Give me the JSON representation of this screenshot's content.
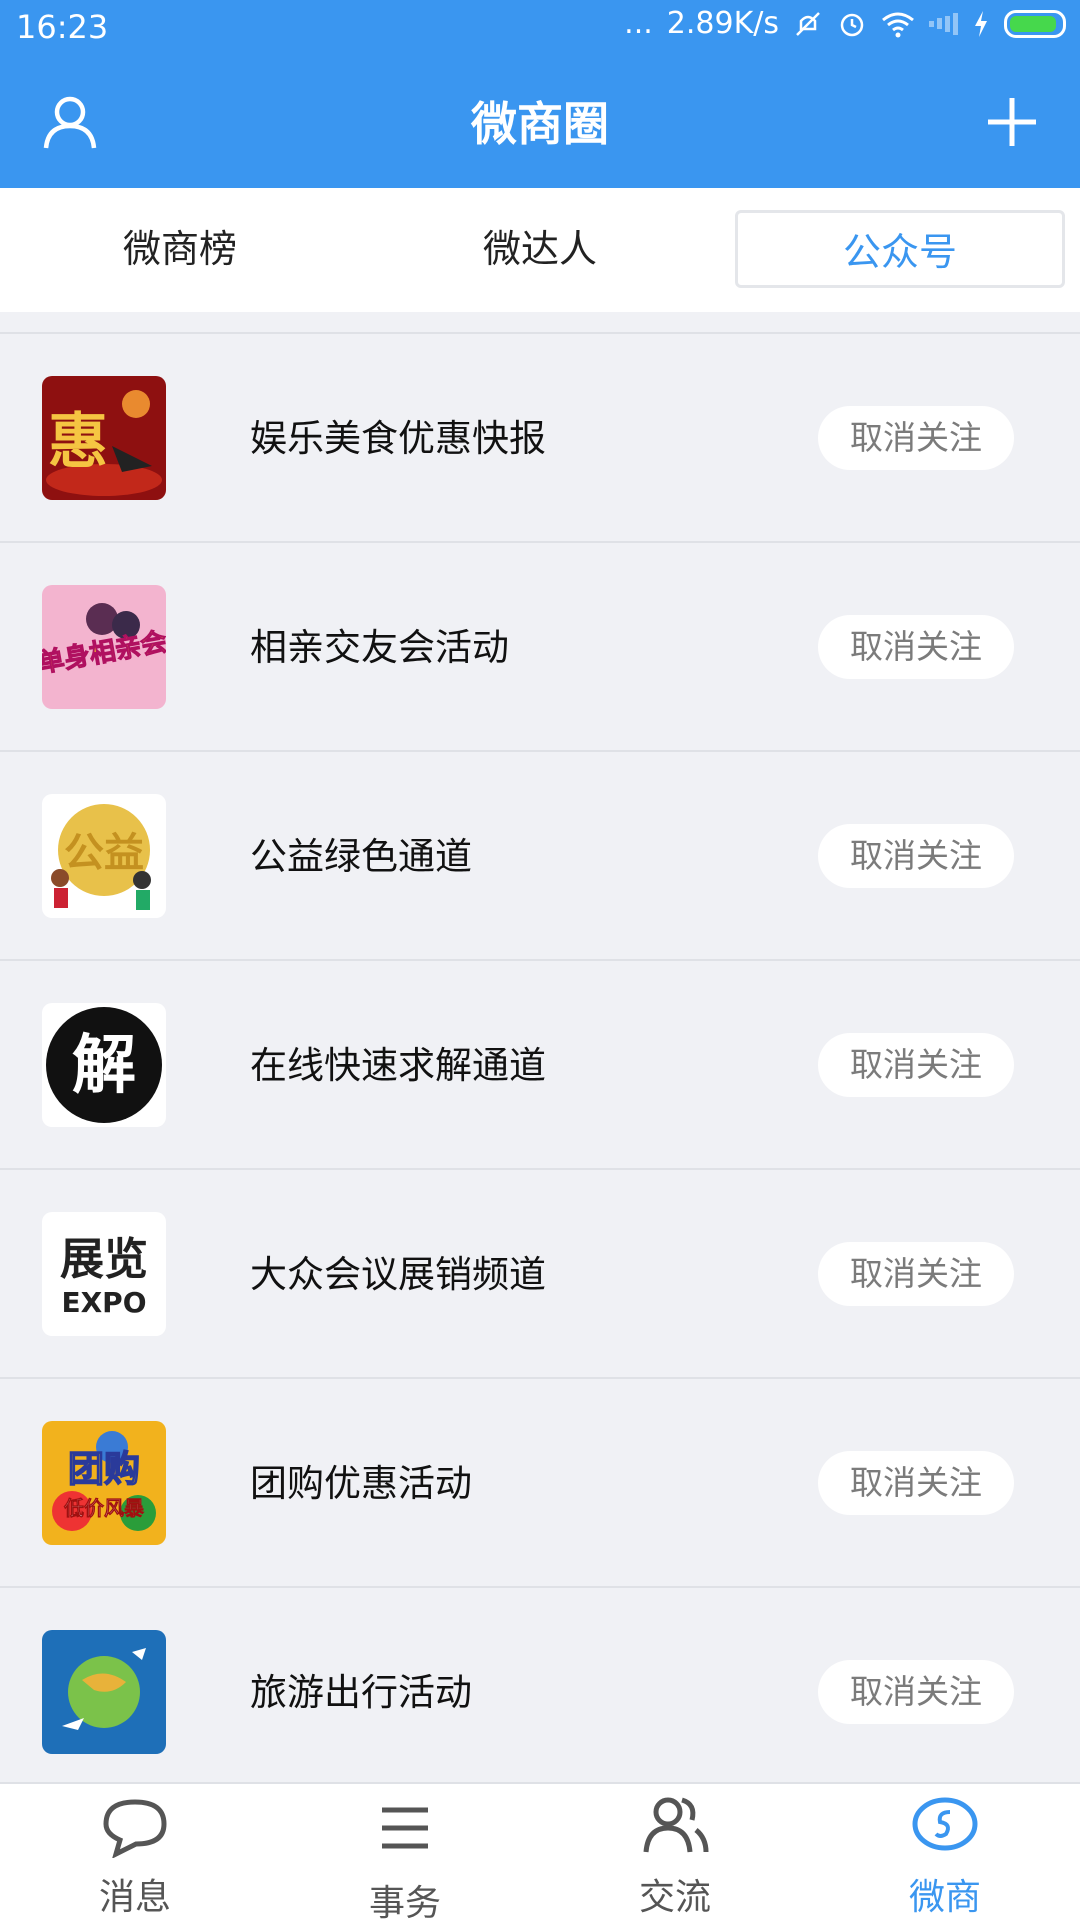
{
  "status_bar": {
    "time": "16:23",
    "dots": "...",
    "speed": "2.89K/s"
  },
  "header": {
    "title": "微商圈",
    "left_icon": "user-icon",
    "right_icon": "plus-icon"
  },
  "tabs": [
    {
      "label": "微商榜",
      "active": false
    },
    {
      "label": "微达人",
      "active": false
    },
    {
      "label": "公众号",
      "active": true
    }
  ],
  "list": {
    "button_label": "取消关注",
    "items": [
      {
        "name": "娱乐美食优惠快报",
        "avatar_text": "惠",
        "avatar_bg": "#8e1010"
      },
      {
        "name": "相亲交友会活动",
        "avatar_text": "单身相亲会",
        "avatar_bg": "#f3b4cf"
      },
      {
        "name": "公益绿色通道",
        "avatar_text": "公益",
        "avatar_bg": "#e8c14a"
      },
      {
        "name": "在线快速求解通道",
        "avatar_text": "解",
        "avatar_bg": "#111111"
      },
      {
        "name": "大众会议展销频道",
        "avatar_text": "展览",
        "avatar_subtext": "EXPO",
        "avatar_bg": "#ffffff"
      },
      {
        "name": "团购优惠活动",
        "avatar_text": "团购",
        "avatar_subtext": "低价风暴",
        "avatar_bg": "#f2b21d"
      },
      {
        "name": "旅游出行活动",
        "avatar_text": "",
        "avatar_bg": "#1e6fb8"
      }
    ]
  },
  "bottom_nav": [
    {
      "label": "消息",
      "icon": "chat-bubble-icon",
      "active": false
    },
    {
      "label": "事务",
      "icon": "menu-lines-icon",
      "active": false
    },
    {
      "label": "交流",
      "icon": "people-icon",
      "active": false
    },
    {
      "label": "微商",
      "icon": "wechat-business-icon",
      "active": true
    }
  ],
  "colors": {
    "primary": "#3a96f0",
    "background": "#f0f1f5",
    "battery": "#46d84c"
  }
}
